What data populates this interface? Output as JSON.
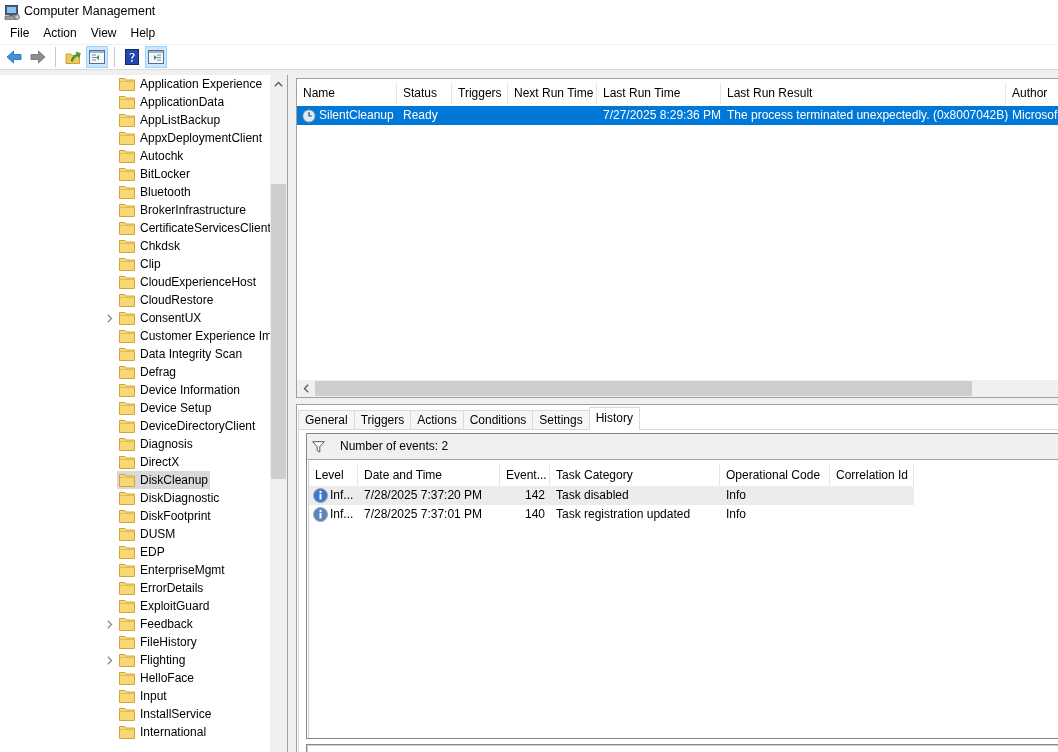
{
  "window": {
    "title": "Computer Management"
  },
  "menu": [
    "File",
    "Action",
    "View",
    "Help"
  ],
  "toolbar": [
    {
      "kind": "back",
      "disabled": false,
      "pressed": false
    },
    {
      "kind": "forward",
      "disabled": true,
      "pressed": false
    },
    {
      "kind": "separator"
    },
    {
      "kind": "up",
      "disabled": false,
      "pressed": false
    },
    {
      "kind": "console_tree",
      "disabled": false,
      "pressed": true
    },
    {
      "kind": "separator"
    },
    {
      "kind": "help",
      "disabled": false,
      "pressed": false
    },
    {
      "kind": "action_pane",
      "disabled": false,
      "pressed": true
    }
  ],
  "tree": {
    "items": [
      {
        "label": "Application Experience",
        "expandable": false,
        "selected": false
      },
      {
        "label": "ApplicationData",
        "expandable": false,
        "selected": false
      },
      {
        "label": "AppListBackup",
        "expandable": false,
        "selected": false
      },
      {
        "label": "AppxDeploymentClient",
        "expandable": false,
        "selected": false
      },
      {
        "label": "Autochk",
        "expandable": false,
        "selected": false
      },
      {
        "label": "BitLocker",
        "expandable": false,
        "selected": false
      },
      {
        "label": "Bluetooth",
        "expandable": false,
        "selected": false
      },
      {
        "label": "BrokerInfrastructure",
        "expandable": false,
        "selected": false
      },
      {
        "label": "CertificateServicesClient",
        "expandable": false,
        "selected": false
      },
      {
        "label": "Chkdsk",
        "expandable": false,
        "selected": false
      },
      {
        "label": "Clip",
        "expandable": false,
        "selected": false
      },
      {
        "label": "CloudExperienceHost",
        "expandable": false,
        "selected": false
      },
      {
        "label": "CloudRestore",
        "expandable": false,
        "selected": false
      },
      {
        "label": "ConsentUX",
        "expandable": true,
        "selected": false
      },
      {
        "label": "Customer Experience Im",
        "expandable": false,
        "selected": false
      },
      {
        "label": "Data Integrity Scan",
        "expandable": false,
        "selected": false
      },
      {
        "label": "Defrag",
        "expandable": false,
        "selected": false
      },
      {
        "label": "Device Information",
        "expandable": false,
        "selected": false
      },
      {
        "label": "Device Setup",
        "expandable": false,
        "selected": false
      },
      {
        "label": "DeviceDirectoryClient",
        "expandable": false,
        "selected": false
      },
      {
        "label": "Diagnosis",
        "expandable": false,
        "selected": false
      },
      {
        "label": "DirectX",
        "expandable": false,
        "selected": false
      },
      {
        "label": "DiskCleanup",
        "expandable": false,
        "selected": true
      },
      {
        "label": "DiskDiagnostic",
        "expandable": false,
        "selected": false
      },
      {
        "label": "DiskFootprint",
        "expandable": false,
        "selected": false
      },
      {
        "label": "DUSM",
        "expandable": false,
        "selected": false
      },
      {
        "label": "EDP",
        "expandable": false,
        "selected": false
      },
      {
        "label": "EnterpriseMgmt",
        "expandable": false,
        "selected": false
      },
      {
        "label": "ErrorDetails",
        "expandable": false,
        "selected": false
      },
      {
        "label": "ExploitGuard",
        "expandable": false,
        "selected": false
      },
      {
        "label": "Feedback",
        "expandable": true,
        "selected": false
      },
      {
        "label": "FileHistory",
        "expandable": false,
        "selected": false
      },
      {
        "label": "Flighting",
        "expandable": true,
        "selected": false
      },
      {
        "label": "HelloFace",
        "expandable": false,
        "selected": false
      },
      {
        "label": "Input",
        "expandable": false,
        "selected": false
      },
      {
        "label": "InstallService",
        "expandable": false,
        "selected": false
      },
      {
        "label": "International",
        "expandable": false,
        "selected": false
      }
    ]
  },
  "task_list": {
    "columns": [
      {
        "label": "Name"
      },
      {
        "label": "Status"
      },
      {
        "label": "Triggers"
      },
      {
        "label": "Next Run Time"
      },
      {
        "label": "Last Run Time"
      },
      {
        "label": "Last Run Result"
      },
      {
        "label": "Author"
      }
    ],
    "rows": [
      {
        "name": "SilentCleanup",
        "status": "Ready",
        "last_run_time": "7/27/2025 8:29:36 PM",
        "last_run_result": "The process terminated unexpectedly. (0x8007042B)",
        "author": "Microsof",
        "selected": true
      }
    ]
  },
  "tabs": [
    {
      "label": "General",
      "selected": false
    },
    {
      "label": "Triggers",
      "selected": false
    },
    {
      "label": "Actions",
      "selected": false
    },
    {
      "label": "Conditions",
      "selected": false
    },
    {
      "label": "Settings",
      "selected": false
    },
    {
      "label": "History",
      "selected": true
    }
  ],
  "history": {
    "event_count": "Number of events: 2",
    "columns": [
      {
        "label": "Level"
      },
      {
        "label": "Date and Time"
      },
      {
        "label": "Event..."
      },
      {
        "label": "Task Category"
      },
      {
        "label": "Operational Code"
      },
      {
        "label": "Correlation Id"
      }
    ],
    "rows": [
      {
        "level": "Inf...",
        "date_time": "7/28/2025 7:37:20 PM",
        "event_id": "142",
        "task_category": "Task disabled",
        "operational_code": "Info",
        "selected": true
      },
      {
        "level": "Inf...",
        "date_time": "7/28/2025 7:37:01 PM",
        "event_id": "140",
        "task_category": "Task registration updated",
        "operational_code": "Info",
        "selected": false
      }
    ]
  }
}
